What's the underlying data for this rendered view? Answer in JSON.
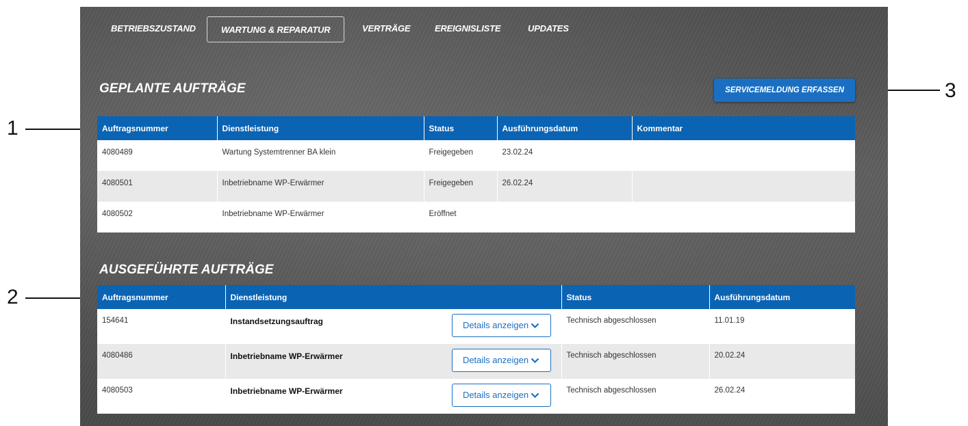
{
  "nav": {
    "items": [
      {
        "label": "BETRIEBSZUSTAND",
        "active": false
      },
      {
        "label": "WARTUNG & REPARATUR",
        "active": true
      },
      {
        "label": "VERTRÄGE",
        "active": false
      },
      {
        "label": "EREIGNISLISTE",
        "active": false
      },
      {
        "label": "UPDATES",
        "active": false
      }
    ]
  },
  "planned": {
    "title": "GEPLANTE AUFTRÄGE",
    "service_button": "SERVICEMELDUNG ERFASSEN",
    "columns": [
      "Auftragsnummer",
      "Dienstleistung",
      "Status",
      "Ausführungsdatum",
      "Kommentar"
    ],
    "rows": [
      {
        "number": "4080489",
        "service": "Wartung Systemtrenner BA klein",
        "status": "Freigegeben",
        "date": "23.02.24",
        "comment": ""
      },
      {
        "number": "4080501",
        "service": "Inbetriebname WP-Erwärmer",
        "status": "Freigegeben",
        "date": "26.02.24",
        "comment": ""
      },
      {
        "number": "4080502",
        "service": "Inbetriebname WP-Erwärmer",
        "status": "Eröffnet",
        "date": "",
        "comment": ""
      }
    ]
  },
  "executed": {
    "title": "AUSGEFÜHRTE AUFTRÄGE",
    "columns": [
      "Auftragsnummer",
      "Dienstleistung",
      "Status",
      "Ausführungsdatum"
    ],
    "details_label": "Details anzeigen",
    "rows": [
      {
        "number": "154641",
        "service": "Instandsetzungsauftrag",
        "status": "Technisch abgeschlossen",
        "date": "11.01.19"
      },
      {
        "number": "4080486",
        "service": "Inbetriebname WP-Erwärmer",
        "status": "Technisch abgeschlossen",
        "date": "20.02.24"
      },
      {
        "number": "4080503",
        "service": "Inbetriebname WP-Erwärmer",
        "status": "Technisch abgeschlossen",
        "date": "26.02.24"
      }
    ]
  },
  "callouts": [
    "1",
    "2",
    "3"
  ],
  "colors": {
    "header_blue": "#0b63b3",
    "button_blue": "#1a6fc2",
    "alt_row": "#e9e9e9"
  }
}
